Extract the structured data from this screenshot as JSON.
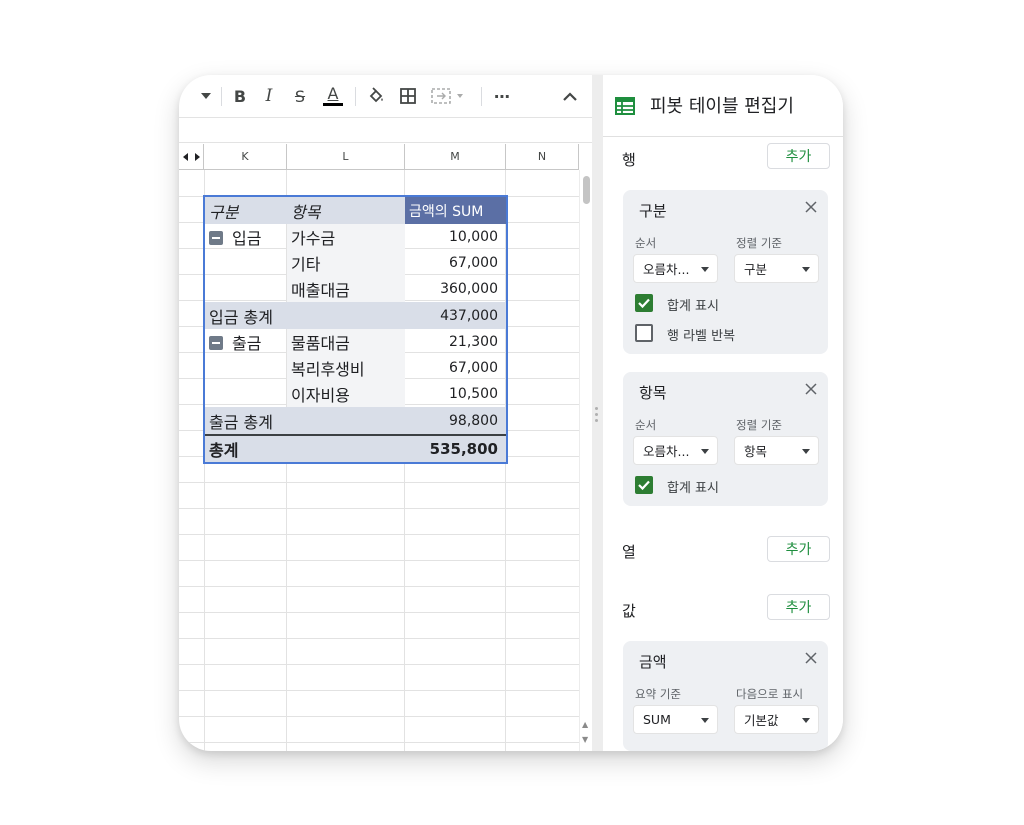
{
  "toolbar": {
    "items": [
      "caret-down-icon",
      "bold-icon",
      "italic-icon",
      "strikethrough-icon",
      "text-color-icon",
      "fill-color-icon",
      "borders-icon",
      "merge-cells-icon",
      "more-icon",
      "collapse-icon"
    ],
    "bold_label": "B",
    "italic_label": "I",
    "strike_label": "S",
    "textcolor_label": "A",
    "more_label": "⋯"
  },
  "sheet": {
    "columns": [
      "K",
      "L",
      "M",
      "N"
    ]
  },
  "pivot_table": {
    "header": {
      "group": "구분",
      "item": "항목",
      "value": "금액의 SUM"
    },
    "rows": [
      {
        "group": "입금",
        "collapsible": true,
        "item": "가수금",
        "value": "10,000"
      },
      {
        "group": "",
        "item": "기타",
        "value": "67,000"
      },
      {
        "group": "",
        "item": "매출대금",
        "value": "360,000"
      },
      {
        "subtotal": "입금 총계",
        "value": "437,000"
      },
      {
        "group": "출금",
        "collapsible": true,
        "item": "물품대금",
        "value": "21,300"
      },
      {
        "group": "",
        "item": "복리후생비",
        "value": "67,000"
      },
      {
        "group": "",
        "item": "이자비용",
        "value": "10,500"
      },
      {
        "subtotal": "출금 총계",
        "value": "98,800"
      },
      {
        "total": "총계",
        "value": "535,800"
      }
    ]
  },
  "editor": {
    "title": "피봇 테이블 편집기",
    "add_label": "추가",
    "rows_label": "행",
    "columns_label": "열",
    "values_label": "값",
    "row_fields": [
      {
        "name": "구분",
        "order_label": "순서",
        "order_value": "오름차...",
        "sort_label": "정렬 기준",
        "sort_value": "구분",
        "show_totals": "합계 표시",
        "show_totals_checked": true,
        "repeat_labels": "행 라벨 반복",
        "repeat_labels_checked": false
      },
      {
        "name": "항목",
        "order_label": "순서",
        "order_value": "오름차...",
        "sort_label": "정렬 기준",
        "sort_value": "항목",
        "show_totals": "합계 표시",
        "show_totals_checked": true
      }
    ],
    "value_fields": [
      {
        "name": "금액",
        "summarize_label": "요약 기준",
        "summarize_value": "SUM",
        "show_as_label": "다음으로 표시",
        "show_as_value": "기본값"
      }
    ]
  },
  "colors": {
    "accent_green": "#1e8e3e",
    "checkbox_green": "#2d7d32",
    "pivot_border": "#4a7ad6",
    "header_blue": "#5b6fa5",
    "band_gray": "#d9dee8"
  }
}
